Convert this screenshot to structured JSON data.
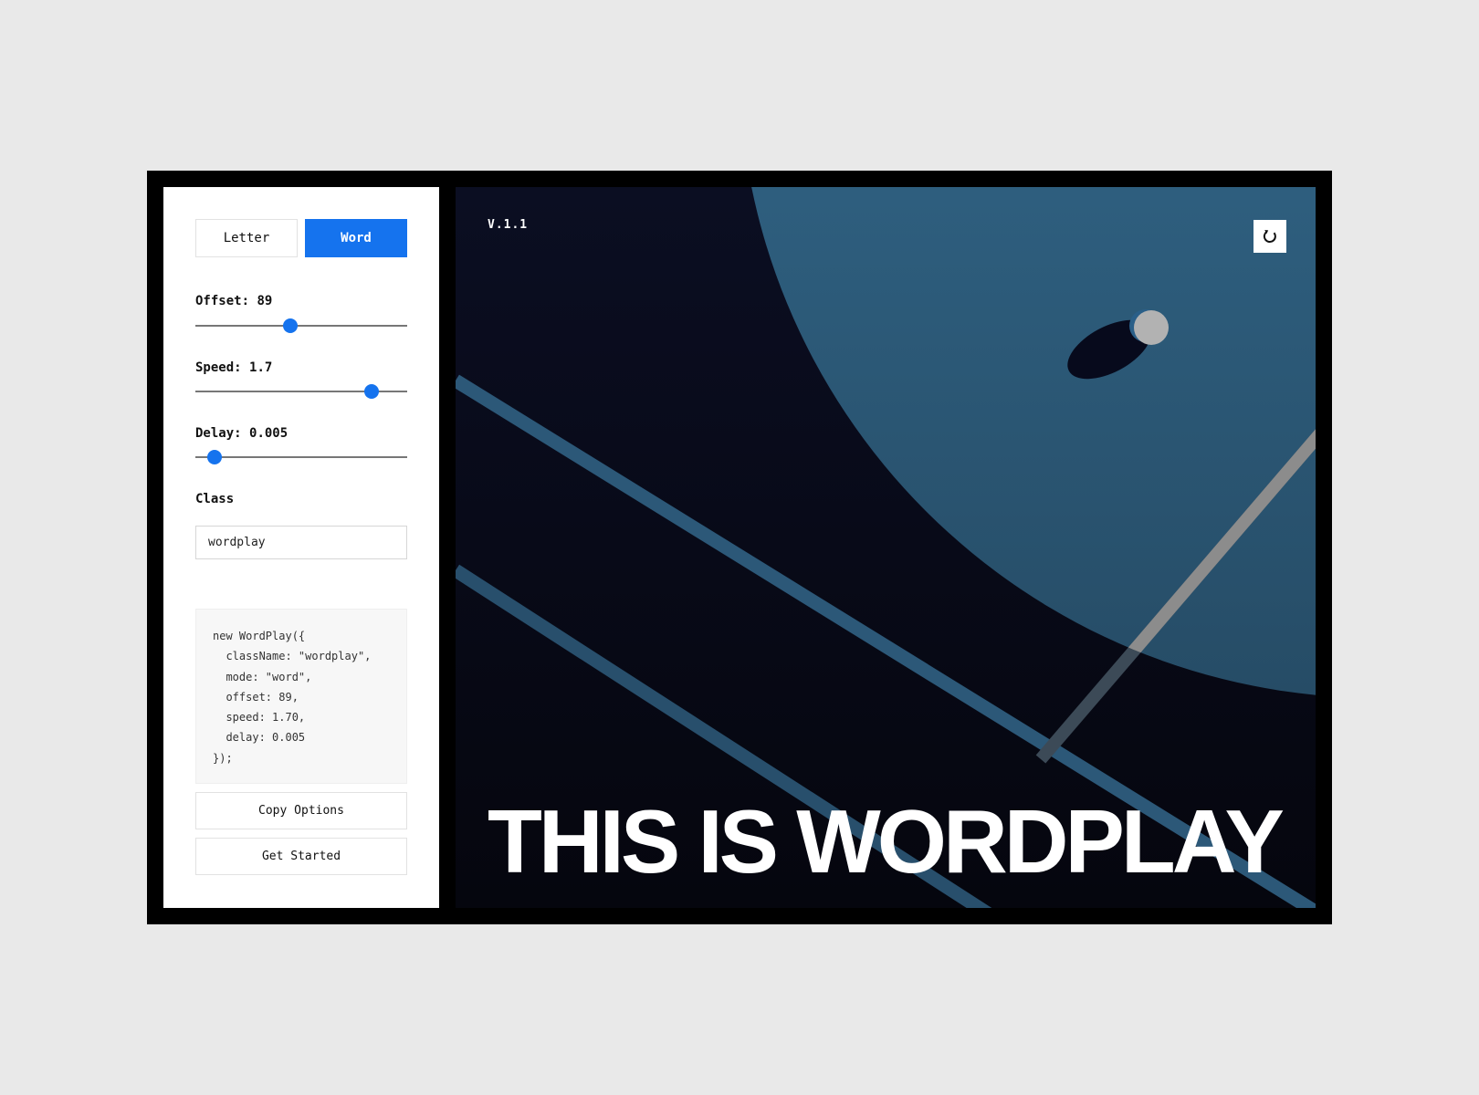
{
  "panel": {
    "mode_buttons": [
      {
        "label": "Letter",
        "active": false
      },
      {
        "label": "Word",
        "active": true
      }
    ],
    "controls": {
      "offset": {
        "label": "Offset: ",
        "value": "89",
        "level": 0.45
      },
      "speed": {
        "label": "Speed: ",
        "value": "1.7",
        "level": 0.83
      },
      "delay": {
        "label": "Delay: ",
        "value": "0.005",
        "level": 0.09
      }
    },
    "class_label": "Class",
    "class_value": "wordplay",
    "code_lines": [
      "new WordPlay({",
      "  className: \"wordplay\",",
      "  mode: \"word\",",
      "  offset: 89,",
      "  speed: 1.70,",
      "  delay: 0.005",
      "});"
    ],
    "copy_label": "Copy Options",
    "start_label": "Get Started"
  },
  "stage": {
    "version": "V.1.1",
    "refresh_icon": "refresh-icon",
    "headline": "THIS IS WORDPLAY"
  },
  "colors": {
    "accent": "#1573ee",
    "stage_bg": "#0a0c1a",
    "planet": "#3a7aa3",
    "stripe": "#2c5878"
  }
}
